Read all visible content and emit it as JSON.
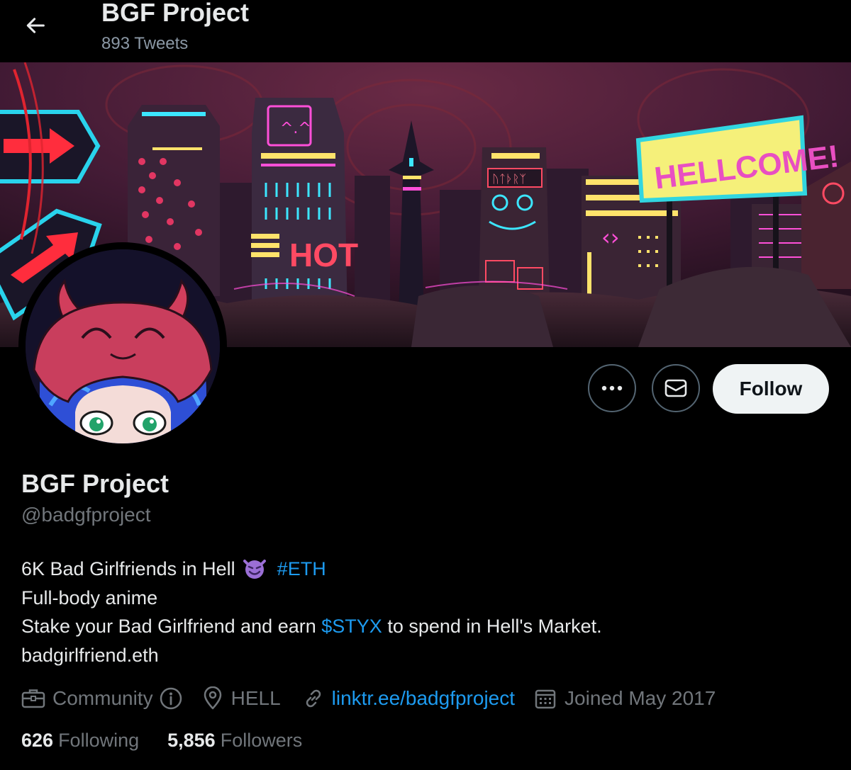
{
  "header": {
    "title": "BGF Project",
    "tweet_count": "893 Tweets"
  },
  "banner": {
    "sign_text": "HELLCOME!",
    "hot_sign": "HOT",
    "tower_sign": "ᚢᛏᚦᚱᛉ"
  },
  "actions": {
    "follow_label": "Follow"
  },
  "profile": {
    "display_name": "BGF Project",
    "handle": "@badgfproject",
    "bio": {
      "line1_text": "6K Bad Girlfriends in Hell",
      "line1_hashtag": "#ETH",
      "line2": "Full-body anime",
      "line3_before": "Stake your Bad Girlfriend and earn",
      "line3_cashtag": "$STYX",
      "line3_after": "to spend in Hell's Market.",
      "line4": "badgirlfriend.eth"
    },
    "category": "Community",
    "location": "HELL",
    "website": "linktr.ee/badgfproject",
    "joined": "Joined May 2017"
  },
  "stats": {
    "following_count": "626",
    "following_label": "Following",
    "followers_count": "5,856",
    "followers_label": "Followers"
  },
  "colors": {
    "accent": "#1d9bf0",
    "muted": "#71767b",
    "text": "#e7e9ea",
    "background": "#000000"
  },
  "icons": {
    "back": "arrow-left-icon",
    "more": "more-icon",
    "message": "envelope-icon",
    "category": "briefcase-icon",
    "info": "info-icon",
    "location": "location-pin-icon",
    "website": "link-icon",
    "joined": "calendar-icon",
    "emoji": "smiling-devil-emoji"
  }
}
